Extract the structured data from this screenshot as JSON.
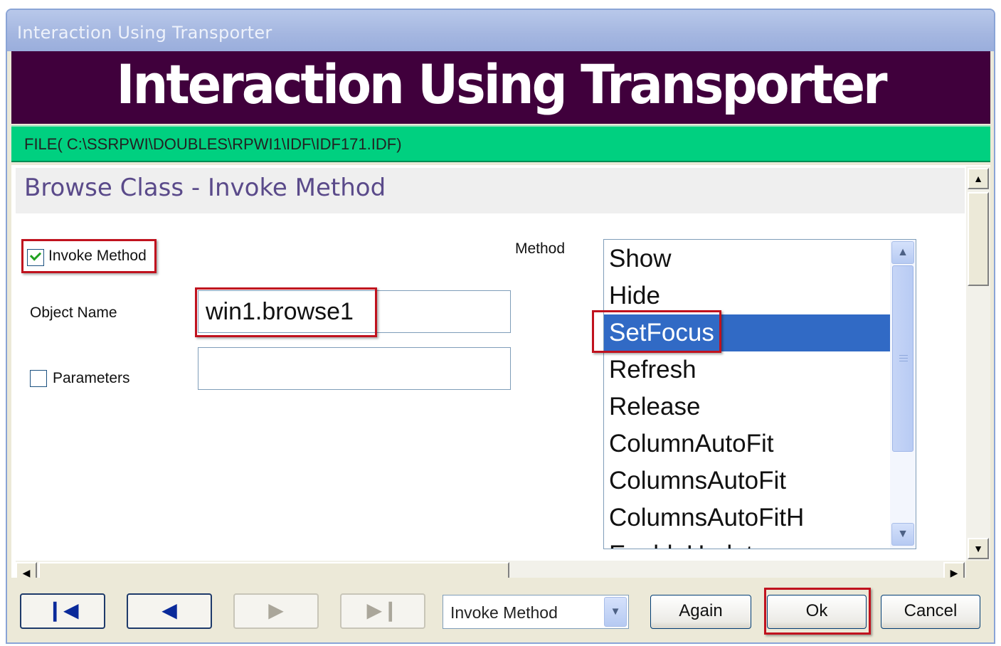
{
  "window": {
    "title": "Interaction Using Transporter"
  },
  "banner": {
    "title": "Interaction Using Transporter"
  },
  "file_bar": {
    "text": "FILE( C:\\SSRPWI\\DOUBLES\\RPWI1\\IDF\\IDF171.IDF)"
  },
  "section": {
    "title": "Browse Class - Invoke Method"
  },
  "form": {
    "invoke_method": {
      "label": "Invoke Method",
      "checked": true
    },
    "object_name": {
      "label": "Object Name",
      "value": "win1.browse1"
    },
    "parameters": {
      "label": "Parameters",
      "checked": false,
      "value": ""
    },
    "method_label": "Method",
    "methods": [
      "Show",
      "Hide",
      "SetFocus",
      "Refresh",
      "Release",
      "ColumnAutoFit",
      "ColumnsAutoFit",
      "ColumnsAutoFitH",
      "EnableUpdate"
    ],
    "selected_method": "SetFocus"
  },
  "footer": {
    "action_dropdown": "Invoke Method",
    "again_label": "Again",
    "ok_label": "Ok",
    "cancel_label": "Cancel"
  },
  "icons": {
    "first": "first-record-icon",
    "prev": "prev-record-icon",
    "next": "next-record-icon",
    "last": "last-record-icon"
  },
  "colors": {
    "banner": "#40003c",
    "file_bar": "#00d080",
    "selection": "#316ac5",
    "highlight_box": "#c0121e"
  }
}
